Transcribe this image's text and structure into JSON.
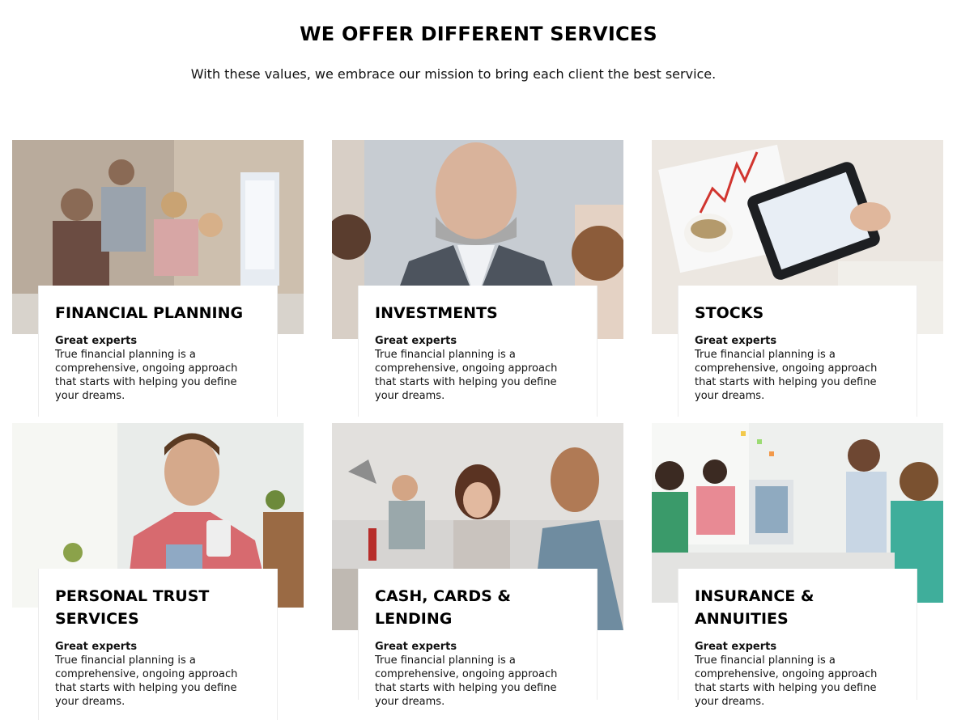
{
  "header": {
    "title": "WE OFFER DIFFERENT SERVICES",
    "subtitle": "With these values, we embrace our mission to bring each client the best service."
  },
  "services": [
    {
      "title": "FINANCIAL PLANNING",
      "subtitle": "Great experts",
      "text": "True financial planning is a comprehensive, ongoing approach that starts with helping you define your dreams.",
      "image": "team-at-computer-photo"
    },
    {
      "title": "INVESTMENTS",
      "subtitle": "Great experts",
      "text": "True financial planning is a comprehensive, ongoing approach that starts with helping you define your dreams.",
      "image": "businessman-portrait-photo"
    },
    {
      "title": "STOCKS",
      "subtitle": "Great experts",
      "text": "True financial planning is a comprehensive, ongoing approach that starts with helping you define your dreams.",
      "image": "tablet-charts-photo"
    },
    {
      "title": "PERSONAL TRUST SERVICES",
      "subtitle": "Great experts",
      "text": "True financial planning is a comprehensive, ongoing approach that starts with helping you define your dreams.",
      "image": "man-with-phone-photo"
    },
    {
      "title": "CASH, CARDS & LENDING",
      "subtitle": "Great experts",
      "text": "True financial planning is a comprehensive, ongoing approach that starts with helping you define your dreams.",
      "image": "office-workers-photo"
    },
    {
      "title": "INSURANCE & ANNUITIES",
      "subtitle": "Great experts",
      "text": "True financial planning is a comprehensive, ongoing approach that starts with helping you define your dreams.",
      "image": "team-meeting-photo"
    }
  ]
}
